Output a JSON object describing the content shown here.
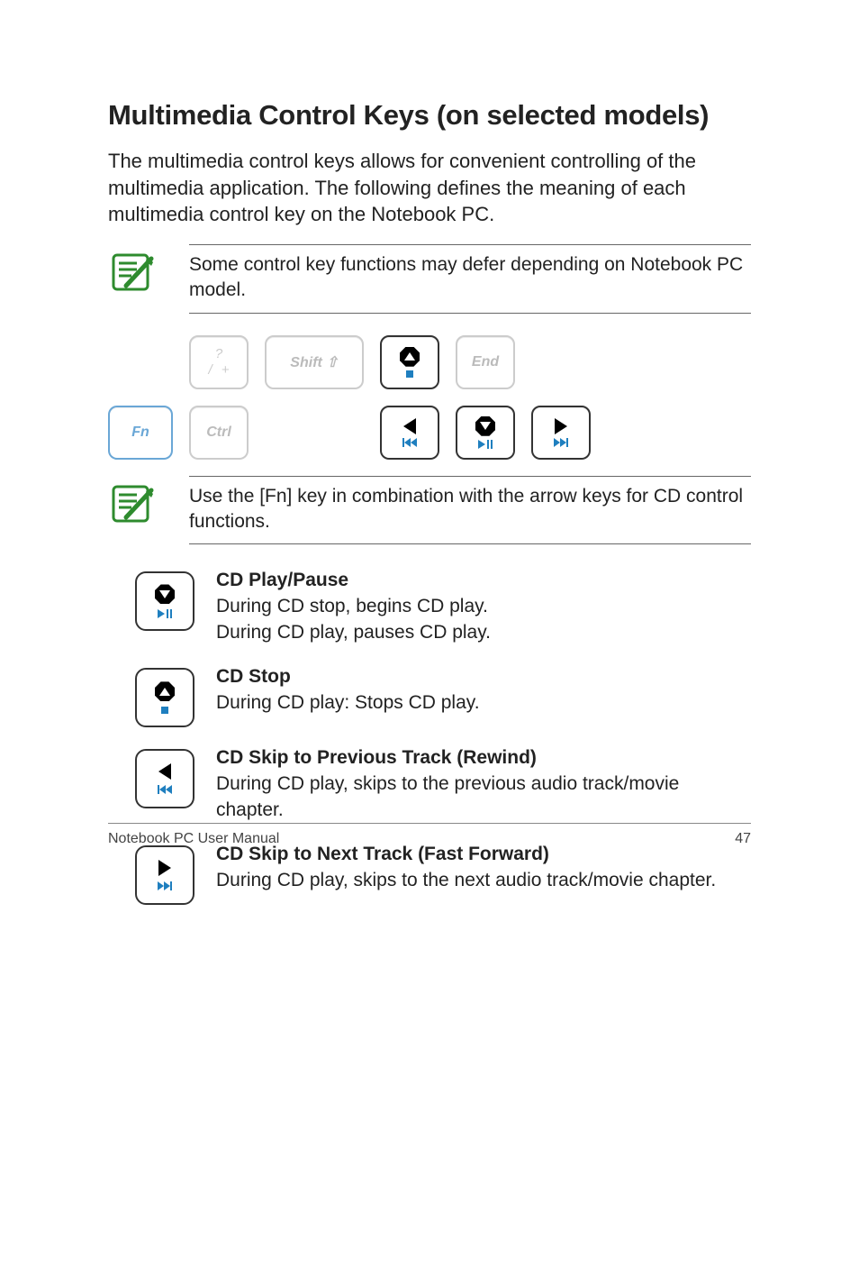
{
  "heading": "Multimedia Control Keys (on selected models)",
  "intro": "The multimedia control keys allows for convenient controlling of the multimedia application. The following defines the meaning of each multimedia control key on the Notebook PC.",
  "note1": "Some control key functions may defer depending on Notebook PC model.",
  "keys": {
    "fn": "Fn",
    "slash_top": "?",
    "slash_left": "/",
    "slash_right": "+",
    "shift": "Shift ⇧",
    "end": "End",
    "ctrl": "Ctrl"
  },
  "note2": "Use the [Fn] key in combination with the arrow keys for CD control functions.",
  "items": {
    "play": {
      "title": "CD Play/Pause",
      "line1": "During CD stop, begins CD play.",
      "line2": "During CD play, pauses CD play."
    },
    "stop": {
      "title": "CD Stop",
      "line1": "During CD play: Stops CD play."
    },
    "prev": {
      "title": "CD Skip to Previous Track (Rewind)",
      "line1": "During CD play, skips to the previous audio track/movie chapter."
    },
    "next": {
      "title": "CD Skip to Next Track (Fast Forward)",
      "line1": "During CD play, skips to the next audio track/movie chapter."
    }
  },
  "footer": {
    "left": "Notebook PC User Manual",
    "right": "47"
  }
}
